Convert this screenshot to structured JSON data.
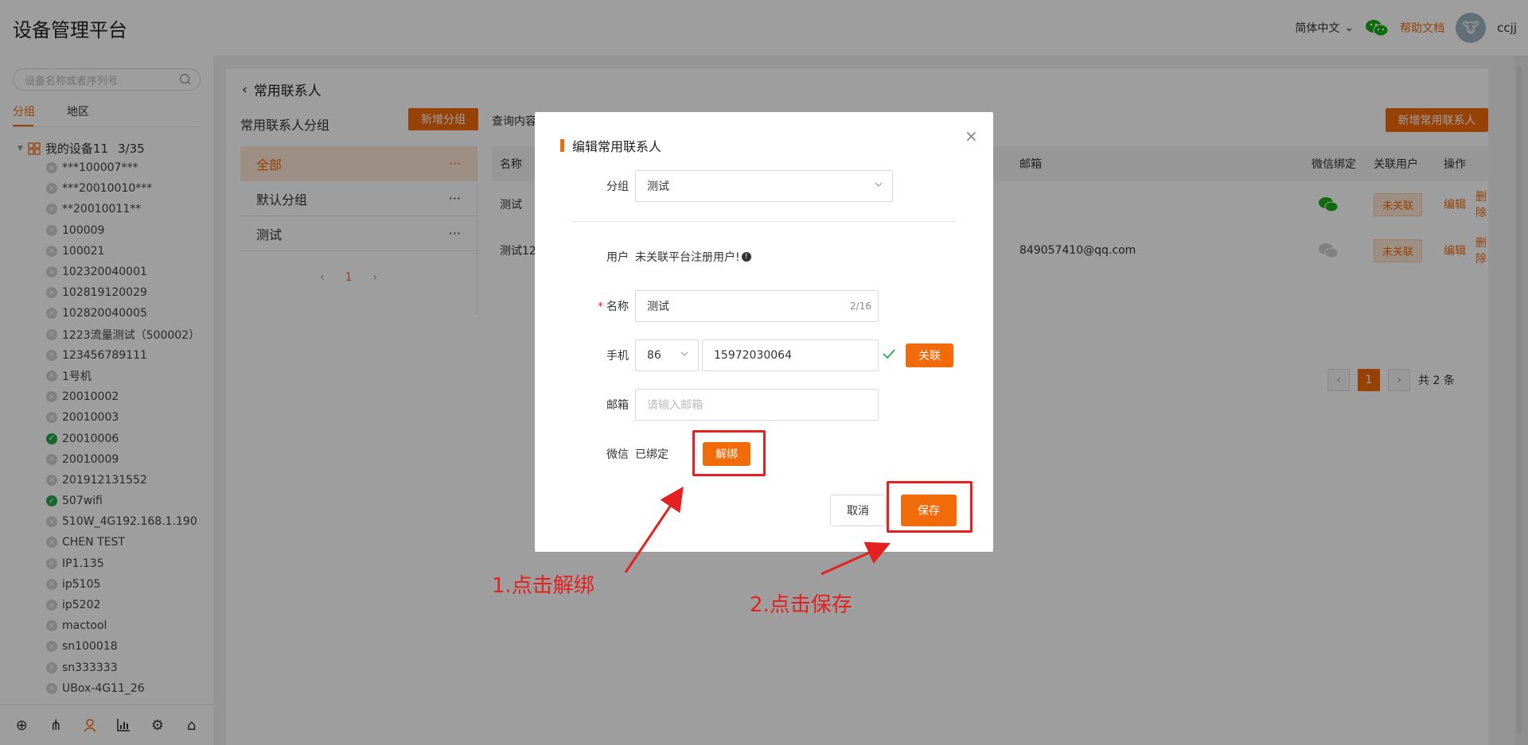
{
  "header": {
    "app_title": "设备管理平台",
    "language": "简体中文",
    "help": "帮助文档",
    "username": "ccjj"
  },
  "sidebar": {
    "search_placeholder": "设备名称或者序列号",
    "tabs": [
      {
        "label": "分组"
      },
      {
        "label": "地区"
      }
    ],
    "tree_root": {
      "label": "我的设备11",
      "count": "3/35"
    },
    "devices": [
      {
        "name": "***100007***",
        "online": false
      },
      {
        "name": "***20010010***",
        "online": false
      },
      {
        "name": "**20010011**",
        "online": false
      },
      {
        "name": "100009",
        "online": false
      },
      {
        "name": "100021",
        "online": false
      },
      {
        "name": "102320040001",
        "online": false
      },
      {
        "name": "102819120029",
        "online": false
      },
      {
        "name": "102820040005",
        "online": false
      },
      {
        "name": "1223流量测试（500002）",
        "online": false
      },
      {
        "name": "123456789111",
        "online": false
      },
      {
        "name": "1号机",
        "online": false
      },
      {
        "name": "20010002",
        "online": false
      },
      {
        "name": "20010003",
        "online": false
      },
      {
        "name": "20010006",
        "online": true
      },
      {
        "name": "20010009",
        "online": false
      },
      {
        "name": "201912131552",
        "online": false
      },
      {
        "name": "507wifi",
        "online": true
      },
      {
        "name": "510W_4G192.168.1.190",
        "online": false
      },
      {
        "name": "CHEN TEST",
        "online": false
      },
      {
        "name": "IP1.135",
        "online": false
      },
      {
        "name": "ip5105",
        "online": false
      },
      {
        "name": "ip5202",
        "online": false
      },
      {
        "name": "mactool",
        "online": false
      },
      {
        "name": "sn100018",
        "online": false
      },
      {
        "name": "sn333333",
        "online": false
      },
      {
        "name": "UBox-4G11_26",
        "online": false
      }
    ],
    "footer_icons": [
      "add-circle-icon",
      "org-tree-icon",
      "user-icon",
      "chart-icon",
      "settings-icon",
      "home-icon"
    ]
  },
  "main": {
    "back_title": "常用联系人",
    "group_title": "常用联系人分组",
    "add_group_btn": "新增分组",
    "query_label": "查询内容",
    "add_contact_btn": "新增常用联系人",
    "groups": [
      {
        "label": "全部",
        "more": "···"
      },
      {
        "label": "默认分组",
        "more": "···"
      },
      {
        "label": "测试",
        "more": "···"
      }
    ],
    "group_pager": {
      "prev": "‹",
      "page": "1",
      "next": "›"
    },
    "table": {
      "headers": {
        "name": "名称",
        "email": "邮箱",
        "wechat": "微信绑定",
        "linked": "关联用户",
        "ops": "操作"
      },
      "rows": [
        {
          "name": "测试",
          "email": "",
          "wechat_bound": true,
          "linked": "未关联",
          "edit": "编辑",
          "delete": "删除"
        },
        {
          "name": "测试12",
          "email": "849057410@qq.com",
          "wechat_bound": false,
          "linked": "未关联",
          "edit": "编辑",
          "delete": "删除"
        }
      ]
    },
    "pager": {
      "prev": "‹",
      "page": "1",
      "next": "›",
      "total": "共 2 条"
    }
  },
  "modal": {
    "title": "编辑常用联系人",
    "close": "×",
    "group_label": "分组",
    "group_value": "测试",
    "user_label": "用户",
    "user_value": "未关联平台注册用户!",
    "name_label": "名称",
    "name_value": "测试",
    "name_counter": "2/16",
    "phone_label": "手机",
    "phone_code": "86",
    "phone_value": "15972030064",
    "link_btn": "关联",
    "email_label": "邮箱",
    "email_placeholder": "请输入邮箱",
    "wechat_label": "微信",
    "wechat_status": "已绑定",
    "unbind_btn": "解绑",
    "cancel_btn": "取消",
    "save_btn": "保存"
  },
  "annotations": {
    "step1": "1.点击解绑",
    "step2": "2.点击保存"
  },
  "colors": {
    "accent": "#f26b0a",
    "annotation": "#e52020",
    "online": "#21a94a",
    "wechat": "#1aad19"
  }
}
